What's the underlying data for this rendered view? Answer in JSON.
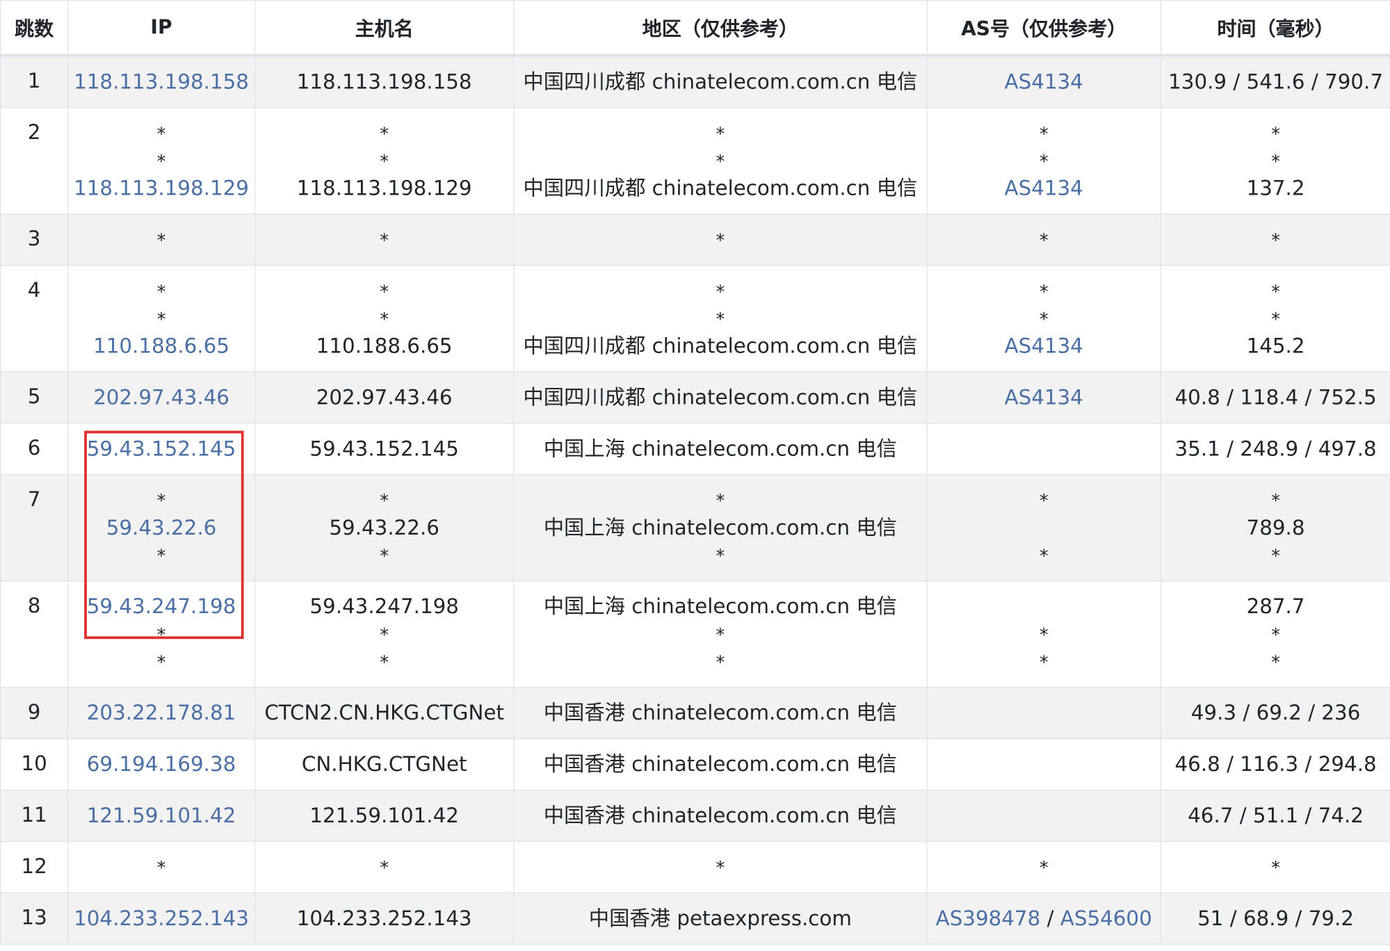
{
  "headers": [
    "跳数",
    "IP",
    "主机名",
    "地区（仅供参考）",
    "AS号（仅供参考）",
    "时间（毫秒）"
  ],
  "rows": [
    {
      "hop": "1",
      "ip": [
        "118.113.198.158"
      ],
      "host": [
        "118.113.198.158"
      ],
      "region": [
        "中国四川成都 chinatelecom.com.cn 电信"
      ],
      "as": [
        [
          "AS4134"
        ]
      ],
      "time": [
        "130.9 / 541.6 / 790.7"
      ]
    },
    {
      "hop": "2",
      "ip": [
        "*",
        "*",
        "118.113.198.129"
      ],
      "host": [
        "*",
        "*",
        "118.113.198.129"
      ],
      "region": [
        "*",
        "*",
        "中国四川成都 chinatelecom.com.cn 电信"
      ],
      "as": [
        [
          "*"
        ],
        [
          "*"
        ],
        [
          "AS4134"
        ]
      ],
      "time": [
        "*",
        "*",
        "137.2"
      ]
    },
    {
      "hop": "3",
      "ip": [
        "*"
      ],
      "host": [
        "*"
      ],
      "region": [
        "*"
      ],
      "as": [
        [
          "*"
        ]
      ],
      "time": [
        "*"
      ]
    },
    {
      "hop": "4",
      "ip": [
        "*",
        "*",
        "110.188.6.65"
      ],
      "host": [
        "*",
        "*",
        "110.188.6.65"
      ],
      "region": [
        "*",
        "*",
        "中国四川成都 chinatelecom.com.cn 电信"
      ],
      "as": [
        [
          "*"
        ],
        [
          "*"
        ],
        [
          "AS4134"
        ]
      ],
      "time": [
        "*",
        "*",
        "145.2"
      ]
    },
    {
      "hop": "5",
      "ip": [
        "202.97.43.46"
      ],
      "host": [
        "202.97.43.46"
      ],
      "region": [
        "中国四川成都 chinatelecom.com.cn 电信"
      ],
      "as": [
        [
          "AS4134"
        ]
      ],
      "time": [
        "40.8 / 118.4 / 752.5"
      ]
    },
    {
      "hop": "6",
      "ip": [
        "59.43.152.145"
      ],
      "host": [
        "59.43.152.145"
      ],
      "region": [
        "中国上海 chinatelecom.com.cn 电信"
      ],
      "as": [],
      "time": [
        "35.1 / 248.9 / 497.8"
      ]
    },
    {
      "hop": "7",
      "ip": [
        "*",
        "59.43.22.6",
        "*"
      ],
      "host": [
        "*",
        "59.43.22.6",
        "*"
      ],
      "region": [
        "*",
        "中国上海 chinatelecom.com.cn 电信",
        "*"
      ],
      "as": [
        [
          "*"
        ],
        [
          ""
        ],
        [
          "*"
        ]
      ],
      "time": [
        "*",
        "789.8",
        "*"
      ]
    },
    {
      "hop": "8",
      "ip": [
        "59.43.247.198",
        "*",
        "*"
      ],
      "host": [
        "59.43.247.198",
        "*",
        "*"
      ],
      "region": [
        "中国上海 chinatelecom.com.cn 电信",
        "*",
        "*"
      ],
      "as": [
        [
          ""
        ],
        [
          "*"
        ],
        [
          "*"
        ]
      ],
      "time": [
        "287.7",
        "*",
        "*"
      ]
    },
    {
      "hop": "9",
      "ip": [
        "203.22.178.81"
      ],
      "host": [
        "CTCN2.CN.HKG.CTGNet"
      ],
      "region": [
        "中国香港 chinatelecom.com.cn 电信"
      ],
      "as": [],
      "time": [
        "49.3 / 69.2 / 236"
      ]
    },
    {
      "hop": "10",
      "ip": [
        "69.194.169.38"
      ],
      "host": [
        "CN.HKG.CTGNet"
      ],
      "region": [
        "中国香港 chinatelecom.com.cn 电信"
      ],
      "as": [],
      "time": [
        "46.8 / 116.3 / 294.8"
      ]
    },
    {
      "hop": "11",
      "ip": [
        "121.59.101.42"
      ],
      "host": [
        "121.59.101.42"
      ],
      "region": [
        "中国香港 chinatelecom.com.cn 电信"
      ],
      "as": [],
      "time": [
        "46.7 / 51.1 / 74.2"
      ]
    },
    {
      "hop": "12",
      "ip": [
        "*"
      ],
      "host": [
        "*"
      ],
      "region": [
        "*"
      ],
      "as": [
        [
          "*"
        ]
      ],
      "time": [
        "*"
      ]
    },
    {
      "hop": "13",
      "ip": [
        "104.233.252.143"
      ],
      "host": [
        "104.233.252.143"
      ],
      "region": [
        "中国香港 petaexpress.com"
      ],
      "as": [
        [
          "AS398478",
          "AS54600"
        ]
      ],
      "time": [
        "51 / 68.9 / 79.2"
      ]
    }
  ],
  "as_separator": " / ",
  "colors": {
    "link": "#4a6fa5",
    "highlight": "#e03131",
    "stripe": "#f2f2f2",
    "border": "#dee2e6"
  }
}
